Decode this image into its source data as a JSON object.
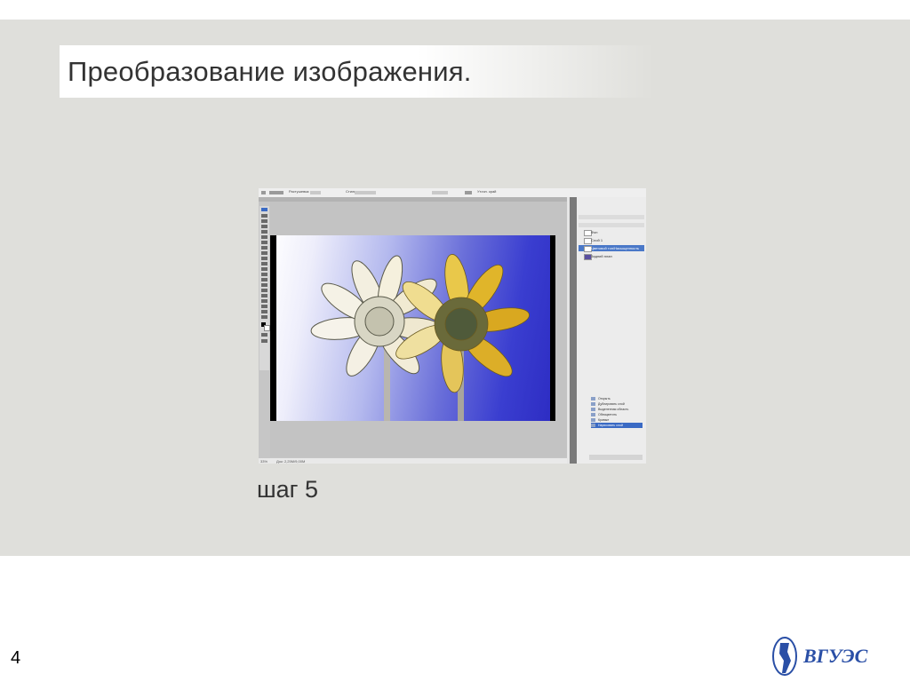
{
  "slide": {
    "title": "Преобразование изображения.",
    "step_label": "шаг 5",
    "page_number": "4",
    "logo_text": "ВГУЭС"
  },
  "photoshop": {
    "options_bar": [
      "Растушевка:",
      "Стиль:",
      "Уточн. край"
    ],
    "zoom_status": "33%",
    "doc_status": "Док: 2,25М/9,00М",
    "layers": [
      {
        "name": "Фон",
        "selected": false
      },
      {
        "name": "Слой 1",
        "selected": false
      },
      {
        "name": "Цветовой тон/Насыщенность",
        "selected": true
      },
      {
        "name": "Задний план",
        "selected": false
      }
    ],
    "history": [
      {
        "name": "Открыть",
        "selected": false
      },
      {
        "name": "Дублировать слой",
        "selected": false
      },
      {
        "name": "Выделенная область",
        "selected": false
      },
      {
        "name": "Обесцветить",
        "selected": false
      },
      {
        "name": "Кривые",
        "selected": false
      },
      {
        "name": "Нарисовать слой",
        "selected": true
      }
    ]
  },
  "colors": {
    "slide_bg": "#dfdfdb",
    "title_color": "#333333",
    "layer_selected": "#4a78c8",
    "logo_blue": "#2a4fa6"
  }
}
